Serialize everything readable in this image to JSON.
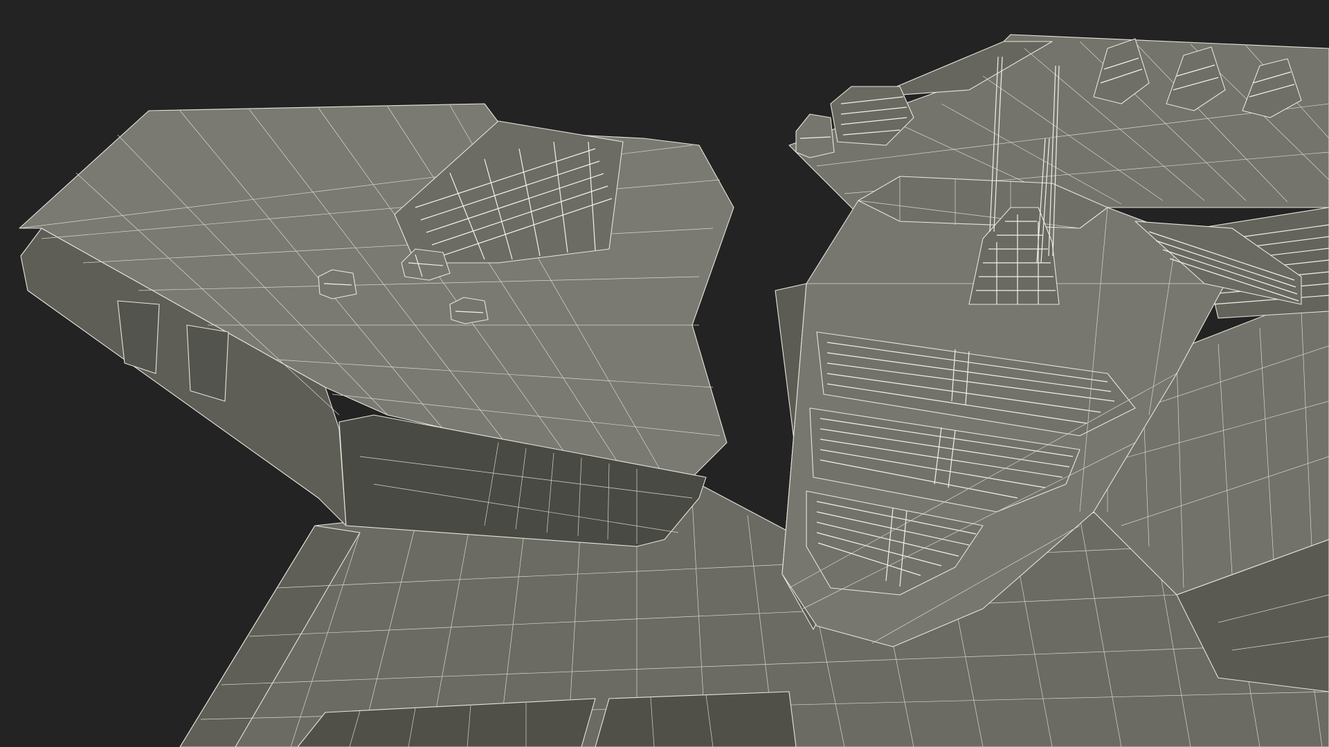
{
  "scene": {
    "subject": "spaceship-wireframe",
    "render_style": "wireframe-over-flat-shading",
    "colors": {
      "background": "#232323",
      "hull_light": "#7b7b72",
      "hull_mid": "#6d6d65",
      "hull_dark": "#5c5c55",
      "hull_shadow": "#4a4a44",
      "wire": "#e6e6dc"
    }
  }
}
